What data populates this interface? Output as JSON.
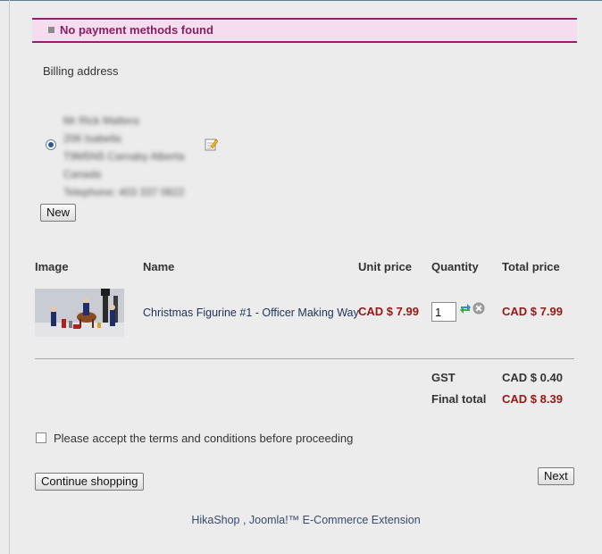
{
  "notice": {
    "message": "No payment methods found"
  },
  "billing": {
    "title": "Billing address",
    "address_lines": [
      "Mr Rick Mattera",
      "206 Isabella",
      "T9M5N5 Carnaby Alberta",
      "Canada",
      "Telephone: 403 337 0822"
    ],
    "new_button": "New"
  },
  "cart": {
    "headers": {
      "image": "Image",
      "name": "Name",
      "unit_price": "Unit price",
      "quantity": "Quantity",
      "total_price": "Total price"
    },
    "items": [
      {
        "name": "Christmas Figurine #1 - Officer Making Way",
        "unit_price": "CAD $ 7.99",
        "quantity": "1",
        "total_price": "CAD $ 7.99"
      }
    ],
    "totals": {
      "tax_label": "GST",
      "tax_value": "CAD $ 0.40",
      "final_label": "Final total",
      "final_value": "CAD $ 8.39"
    }
  },
  "terms": {
    "label": "Please accept the terms and conditions before proceeding"
  },
  "buttons": {
    "continue": "Continue shopping",
    "next": "Next"
  },
  "footer": {
    "text": "HikaShop , Joomla!™ E-Commerce Extension"
  },
  "colors": {
    "notice_border": "#9b1b6c",
    "notice_bg": "#f5dcef",
    "price": "#9b1515",
    "link": "#22335c"
  }
}
